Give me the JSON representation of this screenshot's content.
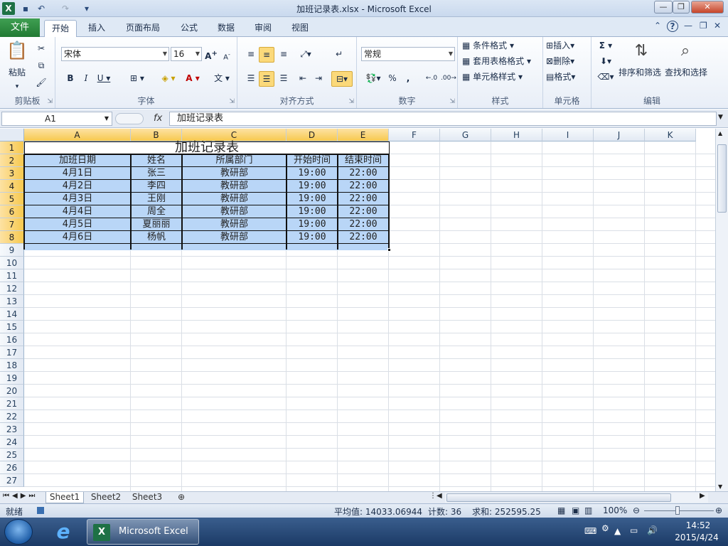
{
  "window": {
    "title": "加班记录表.xlsx - Microsoft Excel"
  },
  "ribbon": {
    "file_tab": "文件",
    "tabs": [
      "开始",
      "插入",
      "页面布局",
      "公式",
      "数据",
      "审阅",
      "视图"
    ],
    "clipboard": {
      "paste": "粘贴",
      "label": "剪贴板"
    },
    "font": {
      "name": "宋体",
      "size": "16",
      "label": "字体"
    },
    "alignment": {
      "label": "对齐方式"
    },
    "number": {
      "format": "常规",
      "label": "数字"
    },
    "styles": {
      "conditional": "条件格式",
      "table_format": "套用表格格式",
      "cell_styles": "单元格样式",
      "label": "样式"
    },
    "cells": {
      "insert": "插入",
      "delete": "删除",
      "format": "格式",
      "label": "单元格"
    },
    "editing": {
      "sort": "排序和筛选",
      "find": "查找和选择",
      "label": "编辑"
    }
  },
  "formula_bar": {
    "name_box": "A1",
    "fx": "fx",
    "value": "加班记录表"
  },
  "columns": [
    "A",
    "B",
    "C",
    "D",
    "E",
    "F",
    "G",
    "H",
    "I",
    "J",
    "K"
  ],
  "rows": [
    "1",
    "2",
    "3",
    "4",
    "5",
    "6",
    "7",
    "8",
    "9",
    "10",
    "11",
    "12",
    "13",
    "14",
    "15",
    "16",
    "17",
    "18",
    "19",
    "20",
    "21",
    "22",
    "23",
    "24",
    "25",
    "26",
    "27"
  ],
  "sheet": {
    "title": "加班记录表",
    "headers": [
      "加班日期",
      "姓名",
      "所属部门",
      "开始时间",
      "结束时间"
    ],
    "records": [
      [
        "4月1日",
        "张三",
        "教研部",
        "19:00",
        "22:00"
      ],
      [
        "4月2日",
        "李四",
        "教研部",
        "19:00",
        "22:00"
      ],
      [
        "4月3日",
        "王刚",
        "教研部",
        "19:00",
        "22:00"
      ],
      [
        "4月4日",
        "周全",
        "教研部",
        "19:00",
        "22:00"
      ],
      [
        "4月5日",
        "夏丽丽",
        "教研部",
        "19:00",
        "22:00"
      ],
      [
        "4月6日",
        "杨帆",
        "教研部",
        "19:00",
        "22:00"
      ]
    ]
  },
  "sheet_tabs": [
    "Sheet1",
    "Sheet2",
    "Sheet3"
  ],
  "status": {
    "mode": "就绪",
    "average": "平均值: 14033.06944",
    "count": "计数: 36",
    "sum": "求和: 252595.25",
    "zoom": "100%"
  },
  "taskbar": {
    "excel_button": "Microsoft Excel ...",
    "time": "14:52",
    "date": "2015/4/24"
  }
}
